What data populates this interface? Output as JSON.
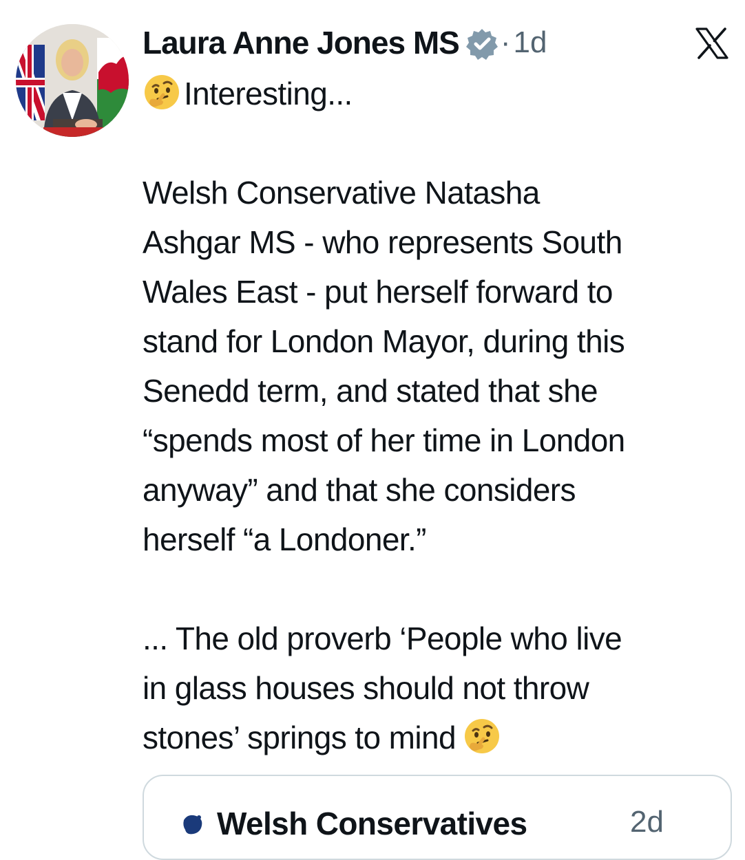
{
  "tweet": {
    "author": {
      "display_name": "Laura Anne Jones MS",
      "verified": true,
      "verified_icon": "verified-badge-icon"
    },
    "separator": "·",
    "timestamp": "1d",
    "platform_icon": "x-logo-icon",
    "lead_emoji": "thinking-face-emoji",
    "lines": [
      "Interesting...",
      "",
      "Welsh Conservative Natasha",
      "Ashgar MS - who represents South",
      "Wales East - put herself forward to",
      "stand for London Mayor, during this",
      "Senedd term, and stated that she",
      "“spends most of her time in London",
      "anyway” and that she considers",
      "herself “a Londoner.”",
      "",
      "... The old proverb ‘People who live",
      "in glass houses should not throw",
      "stones’ springs to mind"
    ],
    "trail_emoji": "thinking-face-emoji"
  },
  "quoted_tweet": {
    "display_name": "Welsh Conservatives",
    "timestamp": "2d"
  },
  "colors": {
    "text": "#0f1419",
    "secondary": "#536471",
    "border": "#cfd9de",
    "verified_badge": "#829aab",
    "emoji": "#f7c948"
  }
}
